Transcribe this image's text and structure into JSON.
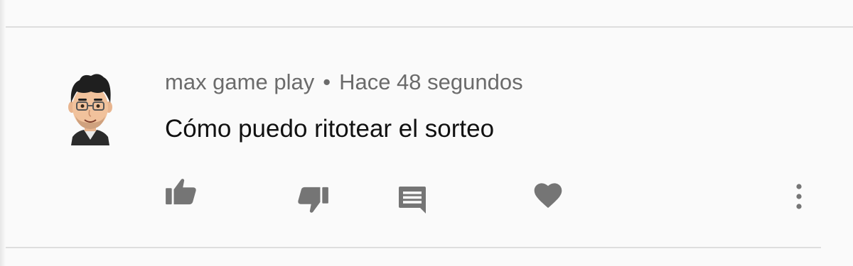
{
  "comment": {
    "author": "max game play",
    "separator": "•",
    "timestamp": "Hace 48 segundos",
    "text": "Cómo puedo ritotear el sorteo"
  },
  "actions": {
    "like_icon": "thumbs-up-icon",
    "dislike_icon": "thumbs-down-icon",
    "reply_icon": "reply-comment-icon",
    "heart_icon": "heart-icon",
    "more_icon": "more-vertical-icon"
  },
  "colors": {
    "background": "#fafafa",
    "icon": "#757575",
    "meta_text": "#6b6b6b",
    "body_text": "#111111",
    "divider": "#dedede"
  }
}
